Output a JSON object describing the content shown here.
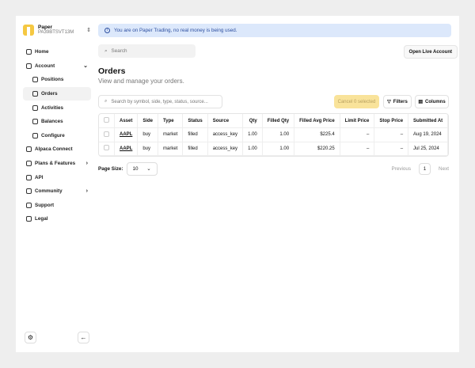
{
  "account": {
    "name": "Paper",
    "id": "PA39BTSVT13M"
  },
  "nav": [
    {
      "label": "Home",
      "sub": false
    },
    {
      "label": "Account",
      "sub": false,
      "chev": "⌄"
    },
    {
      "label": "Positions",
      "sub": true
    },
    {
      "label": "Orders",
      "sub": true,
      "active": true
    },
    {
      "label": "Activities",
      "sub": true
    },
    {
      "label": "Balances",
      "sub": true
    },
    {
      "label": "Configure",
      "sub": true
    },
    {
      "label": "Alpaca Connect",
      "sub": false
    },
    {
      "label": "Plans & Features",
      "sub": false,
      "chev": "›"
    },
    {
      "label": "API",
      "sub": false
    },
    {
      "label": "Community",
      "sub": false,
      "chev": "›"
    },
    {
      "label": "Support",
      "sub": false
    },
    {
      "label": "Legal",
      "sub": false
    }
  ],
  "banner": "You are on Paper Trading, no real money is being used.",
  "search_placeholder": "Search",
  "open_live": "Open Live Account",
  "title": "Orders",
  "subtitle": "View and manage your orders.",
  "table_search_placeholder": "Search by symbol, side, type, status, source...",
  "cancel_label": "Cancel 0 selected",
  "filters_label": "Filters",
  "columns_label": "Columns",
  "columns": [
    "Asset",
    "Side",
    "Type",
    "Status",
    "Source",
    "Qty",
    "Filled Qty",
    "Filled Avg Price",
    "Limit Price",
    "Stop Price",
    "Submitted At"
  ],
  "rows": [
    [
      "AAPL",
      "buy",
      "market",
      "filled",
      "access_key",
      "1.00",
      "1.00",
      "$225.4",
      "–",
      "–",
      "Aug 19, 2024"
    ],
    [
      "AAPL",
      "buy",
      "market",
      "filled",
      "access_key",
      "1.00",
      "1.00",
      "$220.25",
      "–",
      "–",
      "Jul 25, 2024"
    ]
  ],
  "page_size_label": "Page Size:",
  "page_size": "10",
  "previous": "Previous",
  "page": "1",
  "next": "Next"
}
